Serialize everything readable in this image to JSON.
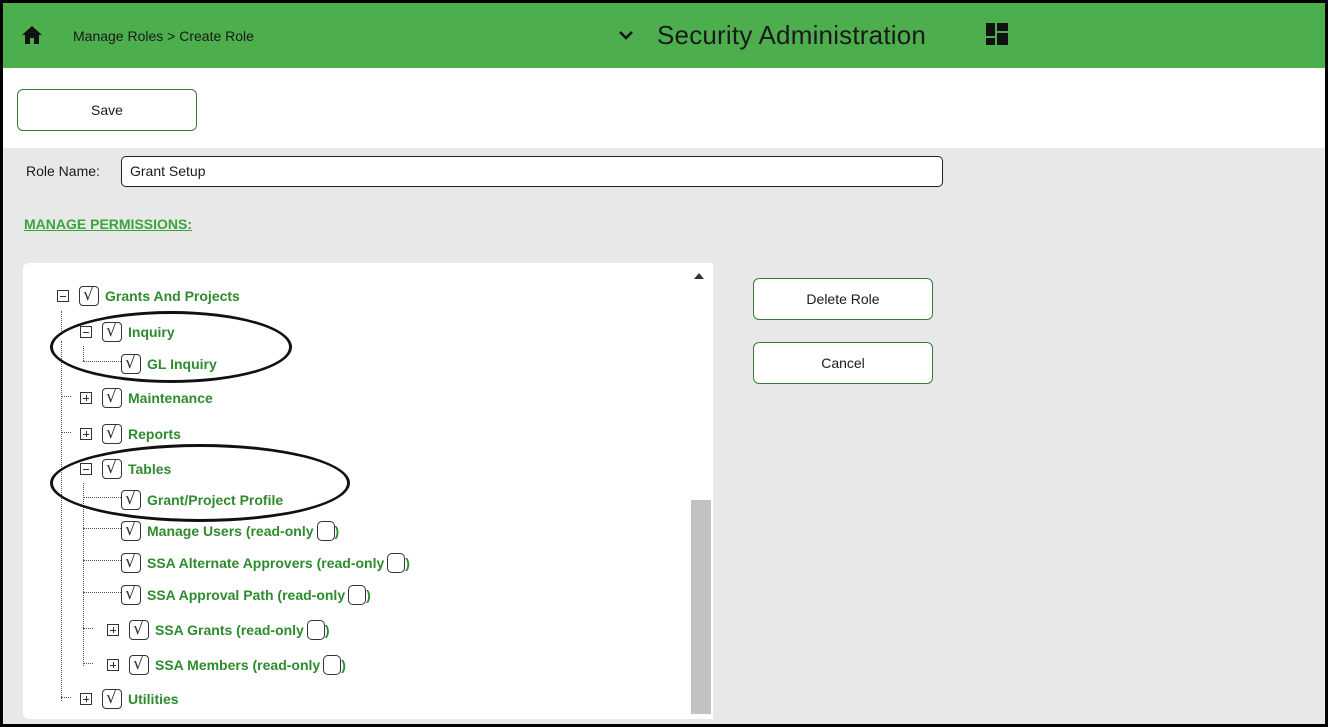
{
  "header": {
    "breadcrumb": "Manage Roles > Create Role",
    "app_title": "Security Administration",
    "home_icon": "home-icon",
    "menu_icon": "chevron-down-icon",
    "apps_icon": "grid-icon",
    "accent": "#4cae4c"
  },
  "toolbar": {
    "save_label": "Save"
  },
  "role": {
    "label": "Role Name:",
    "value": "Grant Setup"
  },
  "permissions": {
    "heading": "MANAGE PERMISSIONS:",
    "nodes": {
      "grants": "Grants And Projects",
      "inquiry": "Inquiry",
      "gl_inquiry": "GL Inquiry",
      "maintenance": "Maintenance",
      "reports": "Reports",
      "tables": "Tables",
      "grant_profile": "Grant/Project Profile",
      "manage_users": "Manage Users (read-only",
      "ssa_alt": "SSA Alternate Approvers (read-only",
      "ssa_path": "SSA Approval Path (read-only",
      "ssa_grants": "SSA Grants (read-only",
      "ssa_members": "SSA Members (read-only",
      "utilities": "Utilities"
    },
    "close_paren": ")"
  },
  "actions": {
    "delete_label": "Delete Role",
    "cancel_label": "Cancel"
  }
}
